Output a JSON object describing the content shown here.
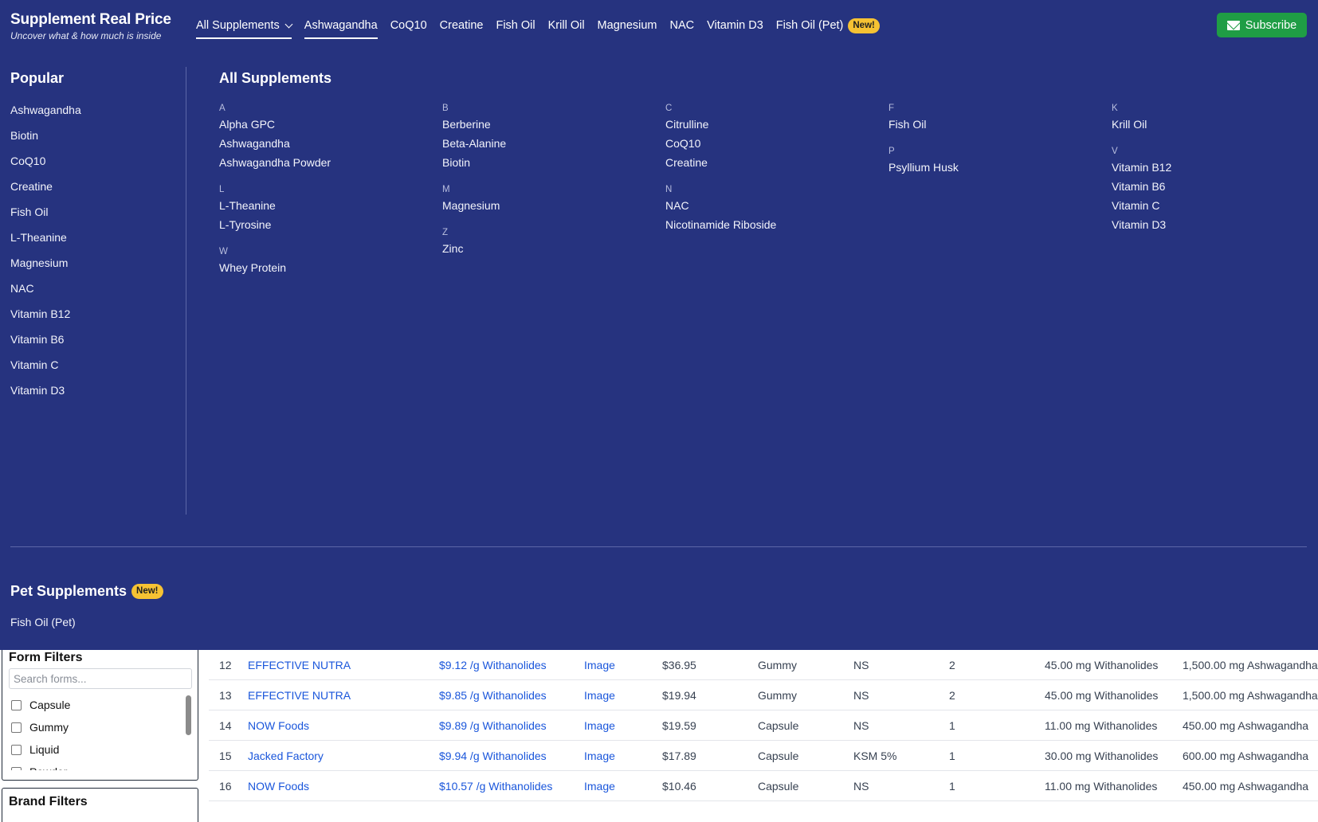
{
  "header": {
    "title": "Supplement Real Price",
    "subtitle": "Uncover what & how much is inside",
    "nav": [
      {
        "label": "All Supplements",
        "dropdown": true,
        "active": true
      },
      {
        "label": "Ashwagandha",
        "active": true
      },
      {
        "label": "CoQ10"
      },
      {
        "label": "Creatine"
      },
      {
        "label": "Fish Oil"
      },
      {
        "label": "Krill Oil"
      },
      {
        "label": "Magnesium"
      },
      {
        "label": "NAC"
      },
      {
        "label": "Vitamin D3"
      },
      {
        "label": "Fish Oil (Pet)",
        "badge": "New!"
      }
    ],
    "subscribe_label": "Subscribe",
    "subscribe_icon": "mail-icon"
  },
  "menu": {
    "popular_title": "Popular",
    "popular": [
      "Ashwagandha",
      "Biotin",
      "CoQ10",
      "Creatine",
      "Fish Oil",
      "L-Theanine",
      "Magnesium",
      "NAC",
      "Vitamin B12",
      "Vitamin B6",
      "Vitamin C",
      "Vitamin D3"
    ],
    "all_title": "All Supplements",
    "columns": [
      [
        {
          "letter": "A",
          "items": [
            "Alpha GPC",
            "Ashwagandha",
            "Ashwagandha Powder"
          ]
        },
        {
          "letter": "L",
          "items": [
            "L-Theanine",
            "L-Tyrosine"
          ]
        },
        {
          "letter": "W",
          "items": [
            "Whey Protein"
          ]
        }
      ],
      [
        {
          "letter": "B",
          "items": [
            "Berberine",
            "Beta-Alanine",
            "Biotin"
          ]
        },
        {
          "letter": "M",
          "items": [
            "Magnesium"
          ]
        },
        {
          "letter": "Z",
          "items": [
            "Zinc"
          ]
        }
      ],
      [
        {
          "letter": "C",
          "items": [
            "Citrulline",
            "CoQ10",
            "Creatine"
          ]
        },
        {
          "letter": "N",
          "items": [
            "NAC",
            "Nicotinamide Riboside"
          ]
        }
      ],
      [
        {
          "letter": "F",
          "items": [
            "Fish Oil"
          ]
        },
        {
          "letter": "P",
          "items": [
            "Psyllium Husk"
          ]
        }
      ],
      [
        {
          "letter": "K",
          "items": [
            "Krill Oil"
          ]
        },
        {
          "letter": "V",
          "items": [
            "Vitamin B12",
            "Vitamin B6",
            "Vitamin C",
            "Vitamin D3"
          ]
        }
      ]
    ],
    "pet_title": "Pet Supplements",
    "pet_badge": "New!",
    "pet_items": [
      "Fish Oil (Pet)"
    ]
  },
  "filters": {
    "form_title": "Form Filters",
    "form_search_placeholder": "Search forms...",
    "form_options": [
      "Capsule",
      "Gummy",
      "Liquid",
      "Powder"
    ],
    "brand_title": "Brand Filters"
  },
  "table": {
    "rows": [
      {
        "idx": "12",
        "brand": "EFFECTIVE NUTRA",
        "price": "$9.12 /g Withanolides",
        "image": "Image",
        "cost": "$36.95",
        "form": "Gummy",
        "extract": "NS",
        "servings": "2",
        "active": "45.00 mg Withanolides",
        "total": "1,500.00 mg Ashwagandha"
      },
      {
        "idx": "13",
        "brand": "EFFECTIVE NUTRA",
        "price": "$9.85 /g Withanolides",
        "image": "Image",
        "cost": "$19.94",
        "form": "Gummy",
        "extract": "NS",
        "servings": "2",
        "active": "45.00 mg Withanolides",
        "total": "1,500.00 mg Ashwagandha"
      },
      {
        "idx": "14",
        "brand": "NOW Foods",
        "price": "$9.89 /g Withanolides",
        "image": "Image",
        "cost": "$19.59",
        "form": "Capsule",
        "extract": "NS",
        "servings": "1",
        "active": "11.00 mg Withanolides",
        "total": "450.00 mg Ashwagandha"
      },
      {
        "idx": "15",
        "brand": "Jacked Factory",
        "price": "$9.94 /g Withanolides",
        "image": "Image",
        "cost": "$17.89",
        "form": "Capsule",
        "extract": "KSM 5%",
        "servings": "1",
        "active": "30.00 mg Withanolides",
        "total": "600.00 mg Ashwagandha"
      },
      {
        "idx": "16",
        "brand": "NOW Foods",
        "price": "$10.57 /g Withanolides",
        "image": "Image",
        "cost": "$10.46",
        "form": "Capsule",
        "extract": "NS",
        "servings": "1",
        "active": "11.00 mg Withanolides",
        "total": "450.00 mg Ashwagandha"
      }
    ]
  },
  "colors": {
    "nav_bg": "#26337f",
    "subscribe_bg": "#1f9d45",
    "badge_bg": "#f6c233",
    "link": "#1a56db"
  }
}
